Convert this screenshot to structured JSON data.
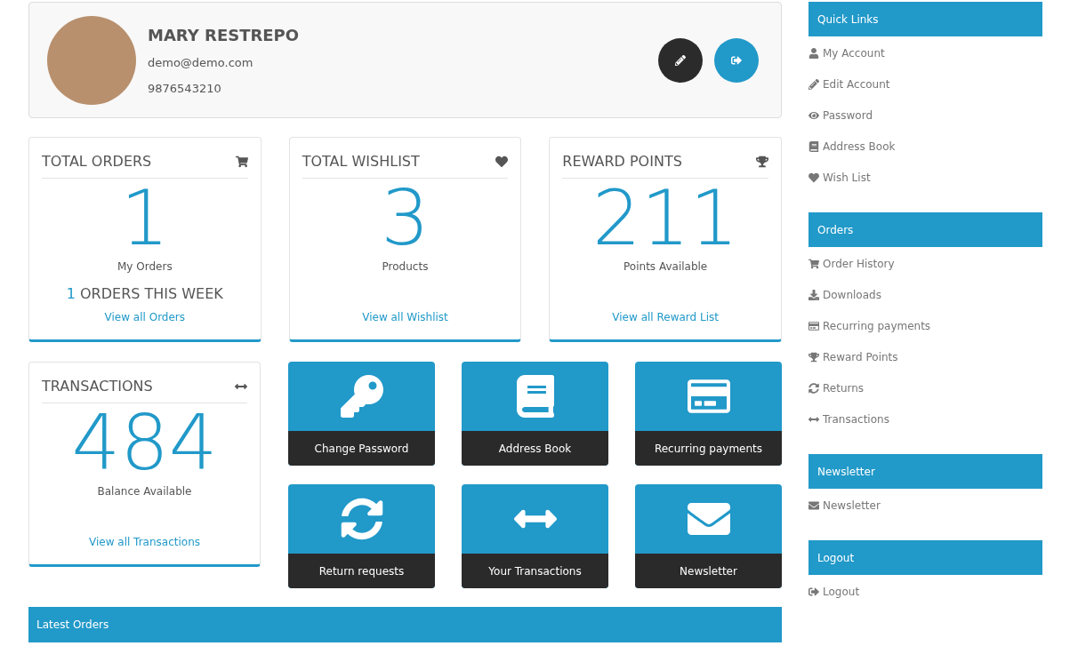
{
  "profile": {
    "name": "MARY RESTREPO",
    "email": "demo@demo.com",
    "phone": "9876543210"
  },
  "stats": [
    {
      "title": "TOTAL ORDERS",
      "value": "1",
      "caption": "My Orders",
      "week_count": "1",
      "week_label": "ORDERS THIS WEEK",
      "link": "View all Orders"
    },
    {
      "title": "TOTAL WISHLIST",
      "value": "3",
      "caption": "Products",
      "link": "View all Wishlist"
    },
    {
      "title": "REWARD POINTS",
      "value": "211",
      "caption": "Points Available",
      "link": "View all Reward List"
    },
    {
      "title": "TRANSACTIONS",
      "value": "484",
      "caption": "Balance Available",
      "link": "View all Transactions"
    }
  ],
  "tiles": [
    "Change Password",
    "Address Book",
    "Recurring payments",
    "Return requests",
    "Your Transactions",
    "Newsletter"
  ],
  "latest_orders": {
    "title": "Latest Orders"
  },
  "sidebar": [
    {
      "title": "Quick Links",
      "items": [
        "My Account",
        "Edit Account",
        "Password",
        "Address Book",
        "Wish List"
      ]
    },
    {
      "title": "Orders",
      "items": [
        "Order History",
        "Downloads",
        "Recurring payments",
        "Reward Points",
        "Returns",
        "Transactions"
      ]
    },
    {
      "title": "Newsletter",
      "items": [
        "Newsletter"
      ]
    },
    {
      "title": "Logout",
      "items": [
        "Logout"
      ]
    }
  ]
}
